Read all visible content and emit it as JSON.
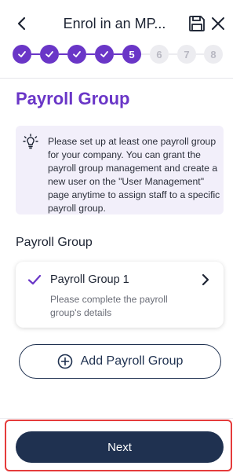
{
  "header": {
    "title": "Enrol in an MP..."
  },
  "stepper": {
    "steps": [
      {
        "label": "",
        "state": "done"
      },
      {
        "label": "",
        "state": "done"
      },
      {
        "label": "",
        "state": "done"
      },
      {
        "label": "",
        "state": "done"
      },
      {
        "label": "5",
        "state": "current"
      },
      {
        "label": "6",
        "state": "future"
      },
      {
        "label": "7",
        "state": "future"
      },
      {
        "label": "8",
        "state": "future"
      }
    ]
  },
  "main": {
    "section_title": "Payroll Group",
    "info_text": "Please set up at least one payroll group for your company. You can grant the payroll group management and create a new user on the \"User Management\" page anytime to assign staff to a specific payroll group.",
    "group_heading": "Payroll Group",
    "card": {
      "title": "Payroll Group 1",
      "subtitle": "Please complete the payroll group's details"
    },
    "add_button_label": "Add Payroll Group"
  },
  "footer": {
    "next_label": "Next"
  },
  "colors": {
    "accent": "#6a36c7",
    "navy": "#1f3150",
    "info_bg": "#f2effa",
    "highlight": "#e53b3b"
  },
  "icons": [
    "back-arrow-icon",
    "save-icon",
    "close-icon",
    "check-icon",
    "lightbulb-icon",
    "chevron-right-icon",
    "plus-circle-icon"
  ]
}
